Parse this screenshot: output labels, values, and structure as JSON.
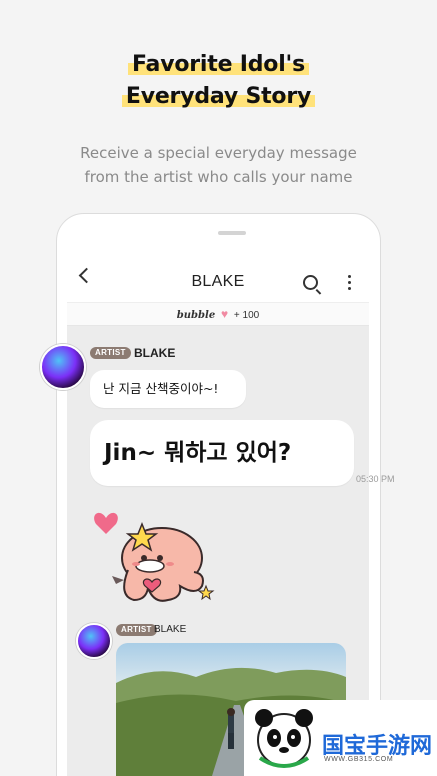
{
  "headline": {
    "line1": "Favorite Idol's",
    "line2": "Everyday Story"
  },
  "subtitle": {
    "line1": "Receive a special everyday message",
    "line2": "from the artist who calls your name"
  },
  "chat": {
    "title": "BLAKE",
    "bubble_bar": {
      "brand": "bubble",
      "count": "+ 100"
    },
    "messages": [
      {
        "badge": "ARTIST",
        "name": "BLAKE",
        "text": "난 지금 산책중이야~!"
      },
      {
        "text": "Jin~ 뭐하고 있어?",
        "time": "05:30 PM"
      }
    ],
    "second_post": {
      "badge": "ARTIST",
      "name": "BLAKE"
    }
  },
  "watermark": {
    "text": "国宝手游网",
    "url": "WWW.GB315.COM"
  },
  "colors": {
    "highlight": "#ffe27a",
    "badge": "#8c7b72",
    "heart": "#f18aa2",
    "watermark": "#1f69d8"
  }
}
